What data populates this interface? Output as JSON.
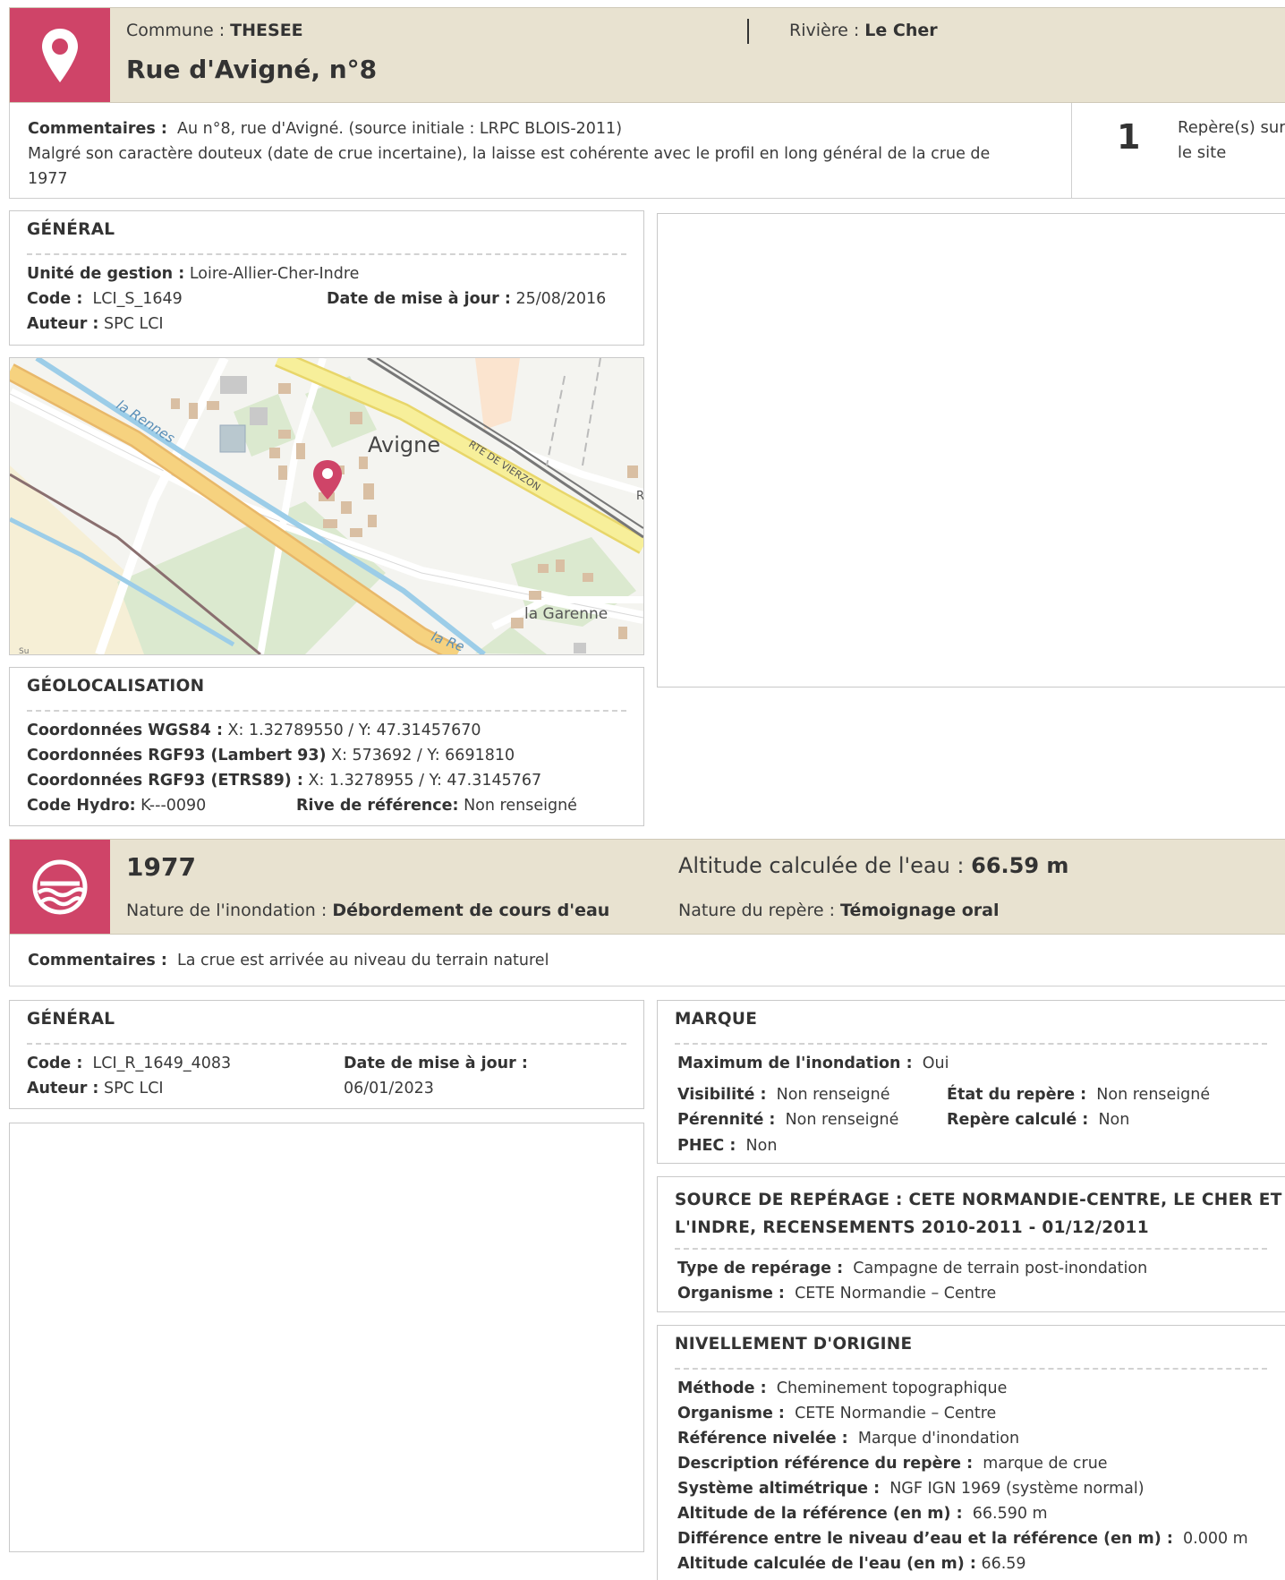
{
  "site": {
    "commune_label": "Commune : ",
    "commune": "THESEE",
    "riviere_label": "Rivière : ",
    "riviere": "Le Cher",
    "title": "Rue d'Avigné, n°8",
    "comment_label": "Commentaires :",
    "comment_line1": "Au n°8, rue d'Avigné. (source initiale : LRPC BLOIS-2011)",
    "comment_line2": "Malgré son caractère douteux (date de crue incertaine), la laisse est cohérente avec le profil en long général de la crue de",
    "comment_line3": "1977",
    "count": "1",
    "count_label_1": "Repère(s) sur",
    "count_label_2": "le site"
  },
  "general": {
    "title": "GÉNÉRAL",
    "unite_label": "Unité de gestion :",
    "unite": "Loire-Allier-Cher-Indre",
    "code_label": "Code :",
    "code": "LCI_S_1649",
    "date_label": "Date de mise à jour :",
    "date": "25/08/2016",
    "auteur_label": "Auteur :",
    "auteur": "SPC LCI"
  },
  "map": {
    "labels": [
      "Avigne",
      "la Rennes",
      "RTE DE VIERZON",
      "la Garenne",
      "la Re",
      "R",
      "Su"
    ],
    "colors": {
      "road_main": "#f5d77a",
      "water": "#9ccde8",
      "green": "#d8e8cf",
      "field": "#f7f0d8",
      "marker": "#cf4468"
    }
  },
  "geo": {
    "title": "GÉOLOCALISATION",
    "wgs_label": "Coordonnées WGS84 :",
    "wgs": "X: 1.32789550 / Y: 47.31457670",
    "lambert_label": "Coordonnées RGF93 (Lambert 93)",
    "lambert": "X: 573692 / Y: 6691810",
    "etrs_label": "Coordonnées RGF93 (ETRS89) :",
    "etrs": "X: 1.3278955 / Y: 47.3145767",
    "hydro_label": "Code Hydro:",
    "hydro": "K---0090",
    "rive_label": "Rive de référence:",
    "rive": "Non renseigné"
  },
  "event": {
    "year": "1977",
    "altitude_label": "Altitude calculée de l'eau : ",
    "altitude": "66.59 m",
    "nature_label": "Nature de l'inondation : ",
    "nature": "Débordement de cours d'eau",
    "repere_label": "Nature du repère : ",
    "repere": "Témoignage oral",
    "comment_label": "Commentaires :",
    "comment": "La crue est arrivée au niveau du terrain naturel"
  },
  "general2": {
    "title": "GÉNÉRAL",
    "code_label": "Code :",
    "code": "LCI_R_1649_4083",
    "date_label": "Date de mise à jour :",
    "date": "06/01/2023",
    "auteur_label": "Auteur :",
    "auteur": "SPC LCI"
  },
  "marque": {
    "title": "MARQUE",
    "max_label": "Maximum de l'inondation :",
    "max": "Oui",
    "visibilite_label": "Visibilité :",
    "visibilite": "Non renseigné",
    "etat_label": "État du repère :",
    "etat": "Non renseigné",
    "perennite_label": "Pérennité :",
    "perennite": "Non renseigné",
    "calcule_label": "Repère calculé :",
    "calcule": "Non",
    "phec_label": "PHEC :",
    "phec": "Non"
  },
  "source": {
    "title_line1": "SOURCE DE REPÉRAGE : CETE NORMANDIE-CENTRE, LE CHER ET",
    "title_line2": "L'INDRE, RECENSEMENTS 2010-2011 - 01/12/2011",
    "type_label": "Type de repérage :",
    "type": "Campagne de terrain post-inondation",
    "org_label": "Organisme :",
    "org": "CETE Normandie – Centre"
  },
  "nivellement": {
    "title": "NIVELLEMENT D'ORIGINE",
    "methode_label": "Méthode :",
    "methode": "Cheminement topographique",
    "org_label": "Organisme :",
    "org": "CETE Normandie – Centre",
    "ref_label": "Référence nivelée :",
    "ref": "Marque d'inondation",
    "desc_label": "Description référence du repère :",
    "desc": "marque de crue",
    "systeme_label": "Système altimétrique :",
    "systeme": "NGF IGN 1969 (système normal)",
    "alt_ref_label": "Altitude de la référence (en m) :",
    "alt_ref": "66.590 m",
    "diff_label": "Différence entre le niveau d’eau et la référence (en m) :",
    "diff": "0.000 m",
    "alt_eau_label": "Altitude calculée de l'eau (en m) :",
    "alt_eau": "66.59"
  }
}
